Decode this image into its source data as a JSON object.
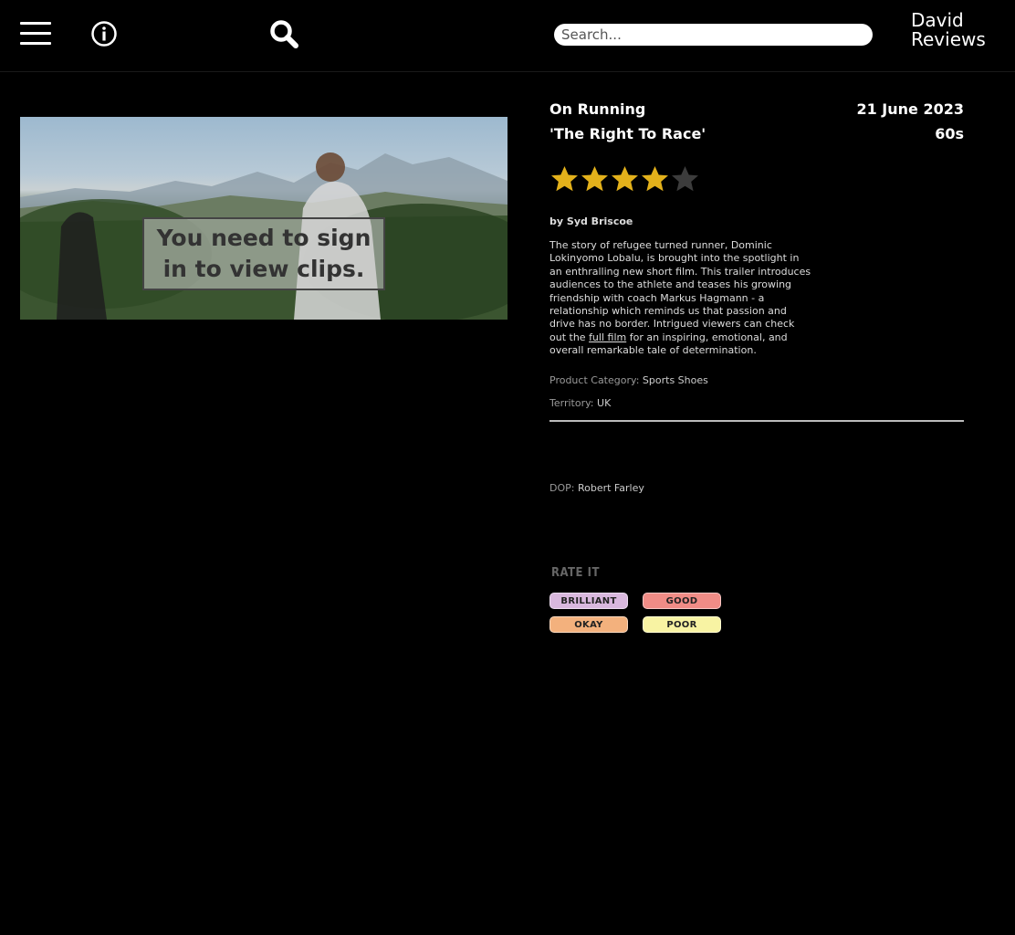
{
  "header": {
    "search_placeholder": "Search...",
    "logo_line1": "David",
    "logo_line2": "Reviews",
    "icons": [
      "menu-icon",
      "info-icon",
      "search-icon"
    ]
  },
  "video": {
    "overlay_text": "You need to sign in to view clips."
  },
  "ad": {
    "brand": "On Running",
    "title": "'The Right To Race'",
    "date": "21 June 2023",
    "duration": "60s",
    "rating": 4,
    "rating_max": 5,
    "byline_prefix": "by",
    "author": "Syd Briscoe",
    "description_before_link": "The story of refugee turned runner, Dominic Lokinyomo Lobalu, is brought into the spotlight in an enthralling new short film. This trailer introduces audiences to the athlete and teases his growing friendship with coach Markus Hagmann - a relationship which reminds us that passion and drive has no border. Intrigued viewers can check out the ",
    "description_link": "full film",
    "description_after_link": " for an inspiring, emotional, and overall remarkable tale of determination.",
    "product_category_label": "Product Category:",
    "product_category": "Sports Shoes",
    "territory_label": "Territory:",
    "territory": "UK",
    "dop_label": "DOP:",
    "dop": "Robert Farley"
  },
  "rate": {
    "label": "RATE IT",
    "buttons": [
      {
        "label": "BRILLIANT",
        "color": "#d9b8de"
      },
      {
        "label": "GOOD",
        "color": "#f08c86"
      },
      {
        "label": "OKAY",
        "color": "#f3b17d"
      },
      {
        "label": "POOR",
        "color": "#f8f3a3"
      }
    ]
  },
  "colors": {
    "star_filled": "#e3b11b",
    "star_empty": "#3c3c3c",
    "background": "#000000"
  }
}
